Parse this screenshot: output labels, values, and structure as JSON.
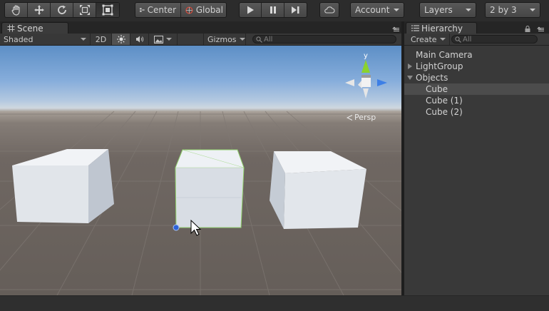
{
  "toolbar": {
    "tools": [
      {
        "name": "hand-tool",
        "icon": "hand-icon"
      },
      {
        "name": "move-tool",
        "icon": "move-arrows-icon"
      },
      {
        "name": "rotate-tool",
        "icon": "rotate-icon"
      },
      {
        "name": "scale-tool",
        "icon": "scale-icon"
      },
      {
        "name": "rect-tool",
        "icon": "rect-transform-icon",
        "active": true
      }
    ],
    "pivot_mode": "Center",
    "pivot_rotation": "Global",
    "play_icon": "play-icon",
    "pause_icon": "pause-icon",
    "step_icon": "step-icon",
    "cloud_icon": "cloud-icon",
    "account_label": "Account",
    "layers_label": "Layers",
    "layout_label": "2 by 3"
  },
  "scene": {
    "tab_label": "Scene",
    "tab_icon": "scene-grid-icon",
    "shading_mode": "Shaded",
    "mode_2d": "2D",
    "lighting_icon": "sun-icon",
    "audio_icon": "speaker-icon",
    "effects_icon": "image-effects-icon",
    "gizmos_label": "Gizmos",
    "search_placeholder": "All",
    "projection_label": "Persp",
    "gizmo_axis_label": "y",
    "objects": [
      {
        "name": "Cube",
        "selected": false
      },
      {
        "name": "Cube",
        "selected": true
      },
      {
        "name": "Cube",
        "selected": false
      }
    ]
  },
  "hierarchy": {
    "tab_label": "Hierarchy",
    "tab_icon": "list-icon",
    "create_label": "Create",
    "search_placeholder": "All",
    "items": [
      {
        "label": "Main Camera",
        "depth": 0,
        "fold": "none",
        "selected": false
      },
      {
        "label": "LightGroup",
        "depth": 0,
        "fold": "closed",
        "selected": false
      },
      {
        "label": "Objects",
        "depth": 0,
        "fold": "open",
        "selected": false
      },
      {
        "label": "Cube",
        "depth": 1,
        "fold": "none",
        "selected": true
      },
      {
        "label": "Cube (1)",
        "depth": 1,
        "fold": "none",
        "selected": false
      },
      {
        "label": "Cube (2)",
        "depth": 1,
        "fold": "none",
        "selected": false
      }
    ]
  },
  "colors": {
    "axis_x": "#ff4444",
    "axis_y": "#8bd22d",
    "axis_z": "#3d7fe6",
    "selection_outline": "#93d36f",
    "pivot_handle": "#2d63d8"
  }
}
